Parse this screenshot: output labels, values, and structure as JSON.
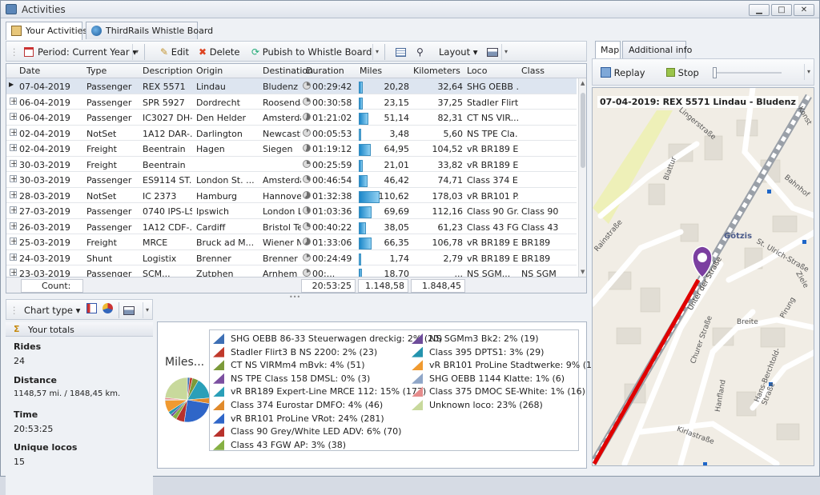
{
  "window": {
    "title": "Activities"
  },
  "tabs": [
    {
      "label": "Your Activities",
      "active": true
    },
    {
      "label": "ThirdRails Whistle Board",
      "active": false
    }
  ],
  "toolbar": {
    "period_label": "Period: Current Year",
    "edit_label": "Edit",
    "delete_label": "Delete",
    "publish_label": "Pubish to Whistle Board",
    "layout_label": "Layout"
  },
  "columns": [
    "Date",
    "Type",
    "Description",
    "Origin",
    "Destination",
    "Duration",
    "Miles",
    "Kilometers",
    "Loco",
    "Class"
  ],
  "rows": [
    {
      "date": "07-04-2019",
      "type": "Passenger",
      "desc": "REX 5571",
      "origin": "Lindau",
      "dest": "Bludenz",
      "dur": "00:29:42",
      "miles": "20,28",
      "km": "32,64",
      "loco": "SHG OEBB ...",
      "cls": "",
      "miles_frac": 0.18,
      "dur_frac": 0.25,
      "exp": "",
      "selected": true
    },
    {
      "date": "06-04-2019",
      "type": "Passenger",
      "desc": "SPR 5927",
      "origin": "Dordrecht",
      "dest": "Roosendaal",
      "dur": "00:30:58",
      "miles": "23,15",
      "km": "37,25",
      "loco": "Stadler Flirt...",
      "cls": "",
      "miles_frac": 0.21,
      "dur_frac": 0.25,
      "exp": "+",
      "selected": false
    },
    {
      "date": "06-04-2019",
      "type": "Passenger",
      "desc": "IC3027 DH-...",
      "origin": "Den Helder",
      "dest": "Amsterdam...",
      "dur": "01:21:02",
      "miles": "51,14",
      "km": "82,31",
      "loco": "CT NS VIR...",
      "cls": "",
      "miles_frac": 0.46,
      "dur_frac": 0.55,
      "exp": "+",
      "selected": false
    },
    {
      "date": "02-04-2019",
      "type": "NotSet",
      "desc": "1A12 DAR-...",
      "origin": "Darlington",
      "dest": "Newcastle",
      "dur": "00:05:53",
      "miles": "3,48",
      "km": "5,60",
      "loco": "NS TPE Cla...",
      "cls": "",
      "miles_frac": 0.03,
      "dur_frac": 0.1,
      "exp": "+",
      "selected": false
    },
    {
      "date": "02-04-2019",
      "type": "Freight",
      "desc": "Beentrain",
      "origin": "Hagen",
      "dest": "Siegen",
      "dur": "01:19:12",
      "miles": "64,95",
      "km": "104,52",
      "loco": "vR BR189 E...",
      "cls": "",
      "miles_frac": 0.59,
      "dur_frac": 0.55,
      "exp": "+",
      "selected": false
    },
    {
      "date": "30-03-2019",
      "type": "Freight",
      "desc": "Beentrain",
      "origin": "",
      "dest": "",
      "dur": "00:25:59",
      "miles": "21,01",
      "km": "33,82",
      "loco": "vR BR189 E...",
      "cls": "",
      "miles_frac": 0.19,
      "dur_frac": 0.25,
      "exp": "+",
      "selected": false
    },
    {
      "date": "30-03-2019",
      "type": "Passenger",
      "desc": "ES9114 ST...",
      "origin": "London St. ...",
      "dest": "Amsterdam...",
      "dur": "00:46:54",
      "miles": "46,42",
      "km": "74,71",
      "loco": "Class 374 E...",
      "cls": "",
      "miles_frac": 0.42,
      "dur_frac": 0.35,
      "exp": "+",
      "selected": false
    },
    {
      "date": "28-03-2019",
      "type": "NotSet",
      "desc": "IC 2373",
      "origin": "Hamburg",
      "dest": "Hannover",
      "dur": "01:32:38",
      "miles": "110,62",
      "km": "178,03",
      "loco": "vR BR101 P...",
      "cls": "",
      "miles_frac": 1.0,
      "dur_frac": 0.6,
      "exp": "+",
      "selected": false
    },
    {
      "date": "27-03-2019",
      "type": "Passenger",
      "desc": "0740 IPS-LST",
      "origin": "Ipswich",
      "dest": "London Liv...",
      "dur": "01:03:36",
      "miles": "69,69",
      "km": "112,16",
      "loco": "Class 90 Gr...",
      "cls": "Class 90",
      "miles_frac": 0.63,
      "dur_frac": 0.45,
      "exp": "+",
      "selected": false
    },
    {
      "date": "26-03-2019",
      "type": "Passenger",
      "desc": "1A12 CDF-...",
      "origin": "Cardiff",
      "dest": "Bristol Tem...",
      "dur": "00:40:22",
      "miles": "38,05",
      "km": "61,23",
      "loco": "Class 43 FG...",
      "cls": "Class 43",
      "miles_frac": 0.34,
      "dur_frac": 0.3,
      "exp": "+",
      "selected": false
    },
    {
      "date": "25-03-2019",
      "type": "Freight",
      "desc": "MRCE",
      "origin": "Bruck ad M...",
      "dest": "Wiener Neu...",
      "dur": "01:33:06",
      "miles": "66,35",
      "km": "106,78",
      "loco": "vR BR189 E...",
      "cls": "BR189",
      "miles_frac": 0.6,
      "dur_frac": 0.6,
      "exp": "+",
      "selected": false
    },
    {
      "date": "24-03-2019",
      "type": "Shunt",
      "desc": "Logistix",
      "origin": "Brenner",
      "dest": "Brenner",
      "dur": "00:24:49",
      "miles": "1,74",
      "km": "2,79",
      "loco": "vR BR189 E...",
      "cls": "BR189",
      "miles_frac": 0.02,
      "dur_frac": 0.2,
      "exp": "+",
      "selected": false
    },
    {
      "date": "23-03-2019",
      "type": "Passenger",
      "desc": "SCM...",
      "origin": "Zutphen",
      "dest": "Arnhem",
      "dur": "00:...",
      "miles": "18,70",
      "km": "...",
      "loco": "NS SGM...",
      "cls": "NS SGM",
      "miles_frac": 0.17,
      "dur_frac": 0.2,
      "exp": "+",
      "selected": false
    }
  ],
  "footer": {
    "count": "Count: 24",
    "duration": "20:53:25",
    "miles": "1.148,58 mi",
    "km": "1.848,45 km"
  },
  "chart_toolbar": {
    "chart_type_label": "Chart type"
  },
  "totals": {
    "header": "Your totals",
    "rides_label": "Rides",
    "rides": "24",
    "distance_label": "Distance",
    "distance": "1148,57 mi. / 1848,45 km.",
    "time_label": "Time",
    "time": "20:53:25",
    "locos_label": "Unique locos",
    "locos": "15"
  },
  "chart_data": {
    "type": "pie",
    "title": "Miles...",
    "categories": [
      "SHG OEBB 86-33 Steuerwagen dreckig",
      "Stadler Flirt3 B NS 2200",
      "CT NS VIRMm4 mBvk",
      "NS TPE Class 158 DMSL",
      "vR BR189 Expert-Line MRCE 112",
      "Class 374 Eurostar DMFO",
      "vR BR101 ProLine VRot",
      "Class 90 Grey/White LED ADV",
      "Class 43 FGW AP",
      "NS SGMm3 Bk2",
      "Class 395 DPTS1",
      "vR BR101 ProLine Stadtwerke",
      "SHG OEBB 1144 Klatte",
      "Class 375 DMOC SE-White",
      "Unknown loco"
    ],
    "values": [
      20,
      23,
      51,
      0,
      177,
      46,
      281,
      70,
      38,
      19,
      29,
      101,
      6,
      16,
      268
    ],
    "percent": [
      2,
      2,
      4,
      0,
      15,
      4,
      24,
      6,
      3,
      2,
      3,
      9,
      1,
      1,
      23
    ],
    "colors": [
      "#3d6fb4",
      "#c0392b",
      "#7c9a3a",
      "#7b4fa0",
      "#2a9fb8",
      "#e08a2c",
      "#2f66c8",
      "#b8322c",
      "#86b043",
      "#6e4c9a",
      "#2494ae",
      "#f09a30",
      "#8fa6c8",
      "#e58c8c",
      "#c8d99c"
    ]
  },
  "legend": [
    "SHG OEBB 86-33 Steuerwagen dreckig: 2% (20)",
    "Stadler Flirt3 B NS 2200: 2% (23)",
    "CT NS VIRMm4 mBvk: 4% (51)",
    "NS TPE Class 158 DMSL: 0% (3)",
    "vR BR189 Expert-Line MRCE 112: 15% (177)",
    "Class 374 Eurostar DMFO: 4% (46)",
    "vR BR101 ProLine VRot: 24% (281)",
    "Class 90 Grey/White LED ADV: 6% (70)",
    "Class 43 FGW AP: 3% (38)",
    "NS SGMm3 Bk2: 2% (19)",
    "Class 395 DPTS1: 3% (29)",
    "vR BR101 ProLine Stadtwerke: 9% (101)",
    "SHG OEBB 1144 Klatte: 1% (6)",
    "Class 375 DMOC SE-White: 1% (16)",
    "Unknown loco: 23% (268)"
  ],
  "map": {
    "tabs": [
      "Map",
      "Additional info"
    ],
    "replay_label": "Replay",
    "stop_label": "Stop",
    "caption": "07-04-2019: REX 5571 Lindau - Bludenz",
    "place": "Götzis",
    "streets": [
      "Blattur",
      "St. Ulrich-Straße",
      "Bahnhof",
      "Breite",
      "Hans-Berchtold-Straße",
      "Churer Straße",
      "Hanfland",
      "Kirlastraße",
      "Unter der Straße",
      "Pirung",
      "Ziele",
      "Konst",
      "Rainstraße",
      "Lingerstraße"
    ]
  }
}
